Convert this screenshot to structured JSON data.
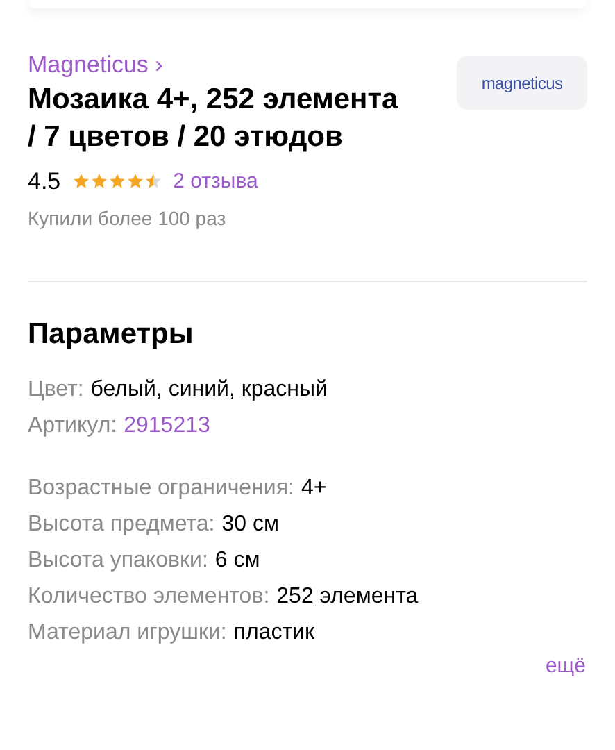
{
  "product": {
    "brand": "Magneticus ›",
    "logo_text": "magneticus",
    "title": "Мозаика 4+, 252 элемента  / 7 цветов / 20 этюдов",
    "rating": "4.5",
    "stars": 4.5,
    "reviews": "2 отзыва",
    "purchases": "Купили более 100 раз"
  },
  "parameters": {
    "heading": "Параметры",
    "groups": [
      [
        {
          "label": "Цвет:",
          "value": "белый, синий, красный",
          "kind": "text"
        },
        {
          "label": "Артикул:",
          "value": "2915213",
          "kind": "link"
        }
      ],
      [
        {
          "label": "Возрастные ограничения:",
          "value": "4+",
          "kind": "text"
        },
        {
          "label": "Высота предмета:",
          "value": "30 см",
          "kind": "text"
        },
        {
          "label": "Высота упаковки:",
          "value": "6 см",
          "kind": "text"
        },
        {
          "label": "Количество элементов:",
          "value": "252 элемента",
          "kind": "text"
        },
        {
          "label": "Материал игрушки:",
          "value": "пластик",
          "kind": "text"
        }
      ]
    ],
    "more": "ещё"
  }
}
